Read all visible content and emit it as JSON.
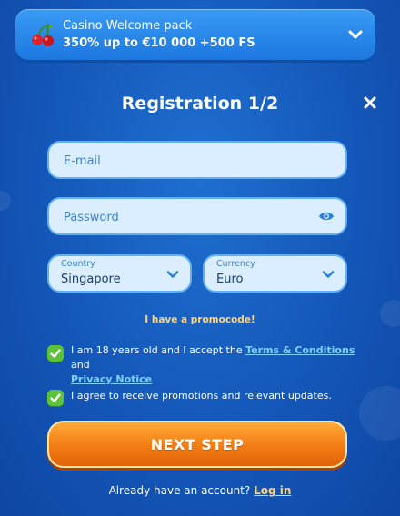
{
  "promo": {
    "line1": "Casino Welcome pack",
    "line2": "350% up to €10 000 +500 FS",
    "icon": "cherry-icon"
  },
  "form": {
    "title": "Registration 1/2",
    "email_placeholder": "E-mail",
    "password_placeholder": "Password",
    "country_label": "Country",
    "country_value": "Singapore",
    "currency_label": "Currency",
    "currency_value": "Euro",
    "promocode_link": "I have a promocode!"
  },
  "consent": {
    "age_text": "I am 18 years old and I accept the",
    "terms_link": "Terms & Conditions",
    "and_text": "and",
    "privacy_link": "Privacy Notice",
    "promo_text": "I agree to receive promotions and relevant updates."
  },
  "actions": {
    "next_label": "NEXT STEP",
    "account_text": "Already have an account?",
    "login_link": "Log in"
  },
  "colors": {
    "background": "#1457b8",
    "accent": "#f37c12",
    "check": "#5cc23b",
    "link": "#7ed3ff"
  }
}
